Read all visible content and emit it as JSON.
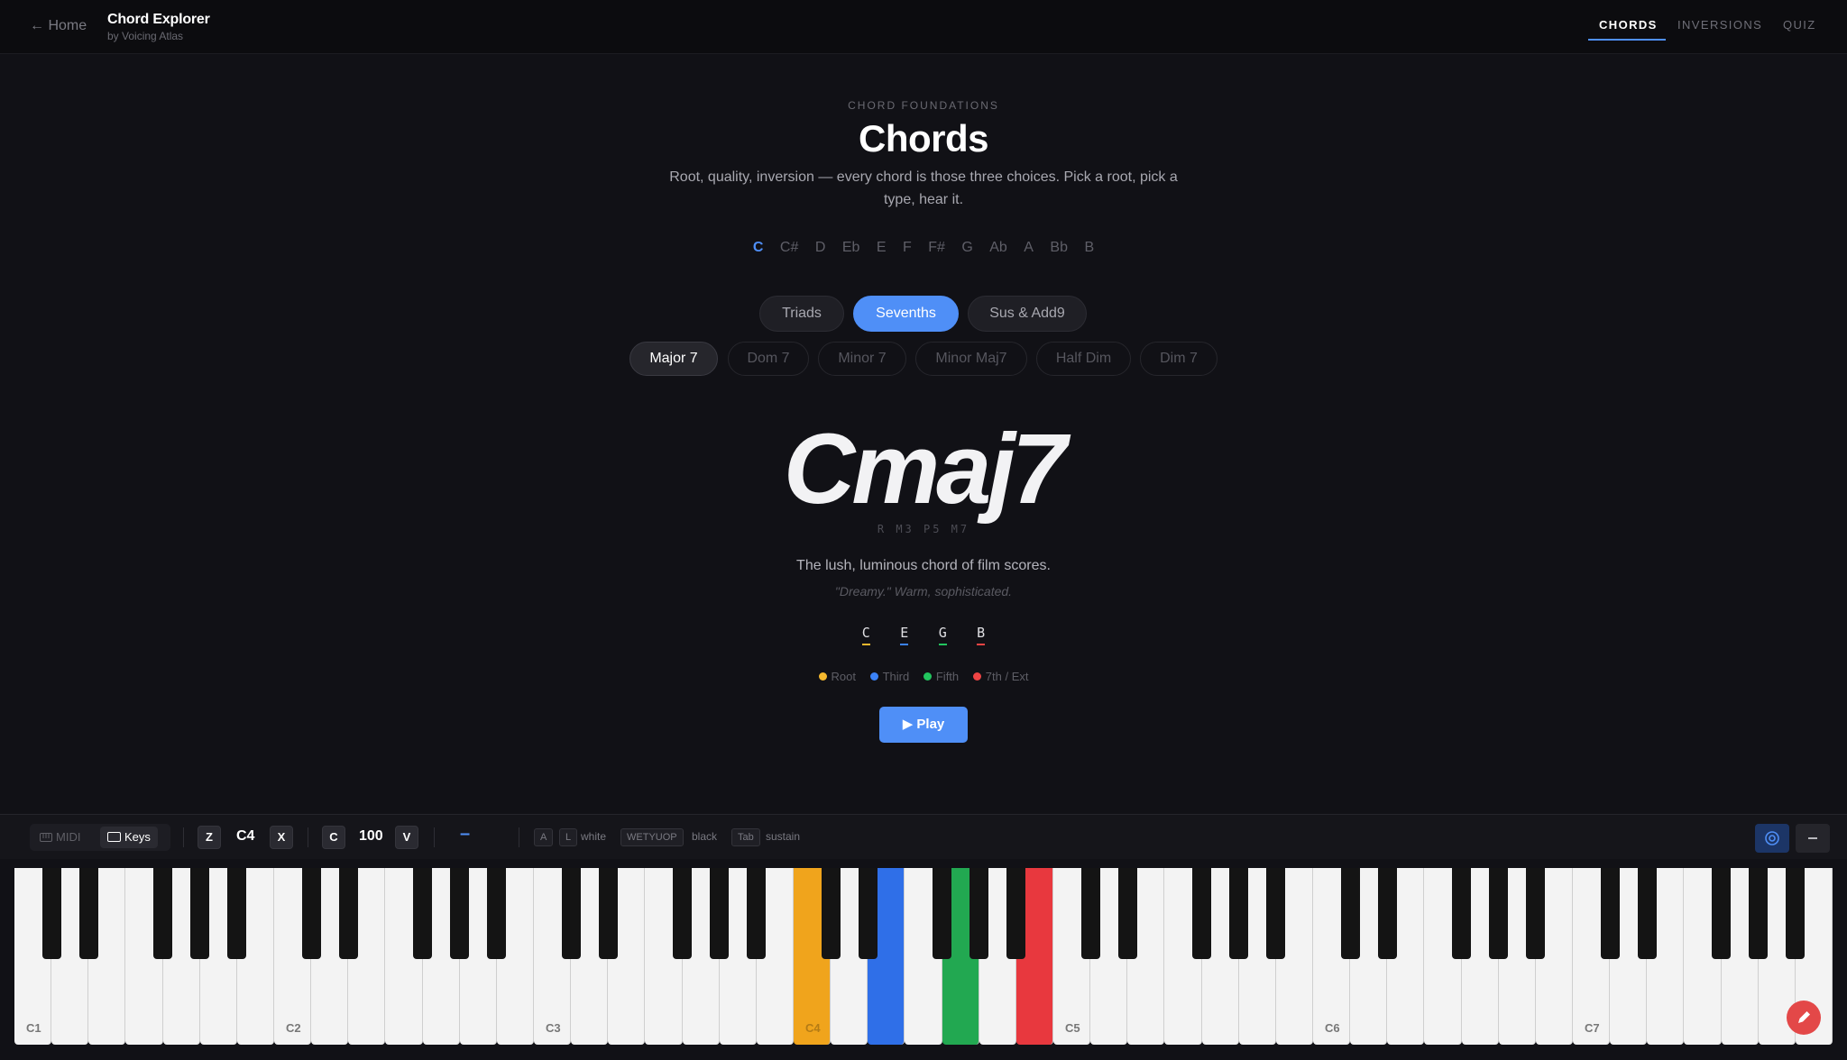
{
  "header": {
    "home_label": "← Home",
    "app_title": "Chord Explorer",
    "app_subtitle": "by Voicing Atlas",
    "tabs": [
      {
        "label": "CHORDS",
        "active": true
      },
      {
        "label": "INVERSIONS",
        "active": false
      },
      {
        "label": "QUIZ",
        "active": false
      }
    ]
  },
  "main": {
    "eyebrow": "CHORD FOUNDATIONS",
    "title": "Chords",
    "subtitle": "Root, quality, inversion — every chord is those three choices. Pick a root, pick a type, hear it.",
    "roots": [
      "C",
      "C#",
      "D",
      "Eb",
      "E",
      "F",
      "F#",
      "G",
      "Ab",
      "A",
      "Bb",
      "B"
    ],
    "selected_root": "C",
    "categories": [
      {
        "label": "Triads",
        "active": false
      },
      {
        "label": "Sevenths",
        "active": true
      },
      {
        "label": "Sus & Add9",
        "active": false
      }
    ],
    "types": [
      {
        "label": "Major 7",
        "active": true
      },
      {
        "label": "Dom 7",
        "active": false
      },
      {
        "label": "Minor 7",
        "active": false
      },
      {
        "label": "Minor Maj7",
        "active": false
      },
      {
        "label": "Half Dim",
        "active": false
      },
      {
        "label": "Dim 7",
        "active": false
      }
    ],
    "chord_name": "Cmaj7",
    "intervals": "R M3 P5 M7",
    "description": "The lush, luminous chord of film scores.",
    "quote": "\"Dreamy.\" Warm, sophisticated.",
    "notes": [
      {
        "name": "C",
        "role": "root"
      },
      {
        "name": "E",
        "role": "third"
      },
      {
        "name": "G",
        "role": "fifth"
      },
      {
        "name": "B",
        "role": "ext"
      }
    ],
    "legend": [
      {
        "label": "Root",
        "color": "#f5b82e"
      },
      {
        "label": "Third",
        "color": "#3b82f6"
      },
      {
        "label": "Fifth",
        "color": "#22c55e"
      },
      {
        "label": "7th / Ext",
        "color": "#ef4444"
      }
    ],
    "play_label": "▶ Play"
  },
  "toolbar": {
    "midi_label": "MIDI",
    "keys_label": "Keys",
    "octave_down_key": "Z",
    "octave_value": "C4",
    "octave_up_key": "X",
    "velocity_down_key": "C",
    "velocity_value": "100",
    "velocity_up_key": "V",
    "dash": "–",
    "hint_white_keys": [
      "A",
      "L"
    ],
    "hint_white_label": "white",
    "hint_black_key": "WETYUOP",
    "hint_black_label": "black",
    "hint_sustain_key": "Tab",
    "hint_sustain_label": "sustain"
  },
  "piano": {
    "octave_labels": [
      "C1",
      "C2",
      "C3",
      "C4",
      "C5",
      "C6",
      "C7"
    ],
    "highlighted": [
      {
        "note": "C4",
        "color": "#f0a41c"
      },
      {
        "note": "E4",
        "color": "#2f6fe8"
      },
      {
        "note": "G4",
        "color": "#22a851"
      },
      {
        "note": "B4",
        "color": "#e8383e"
      }
    ]
  },
  "colors": {
    "accent": "#4f8ff7",
    "root": "#f5b82e",
    "third": "#3b82f6",
    "fifth": "#22c55e",
    "ext": "#ef4444",
    "record": "#e34848"
  }
}
